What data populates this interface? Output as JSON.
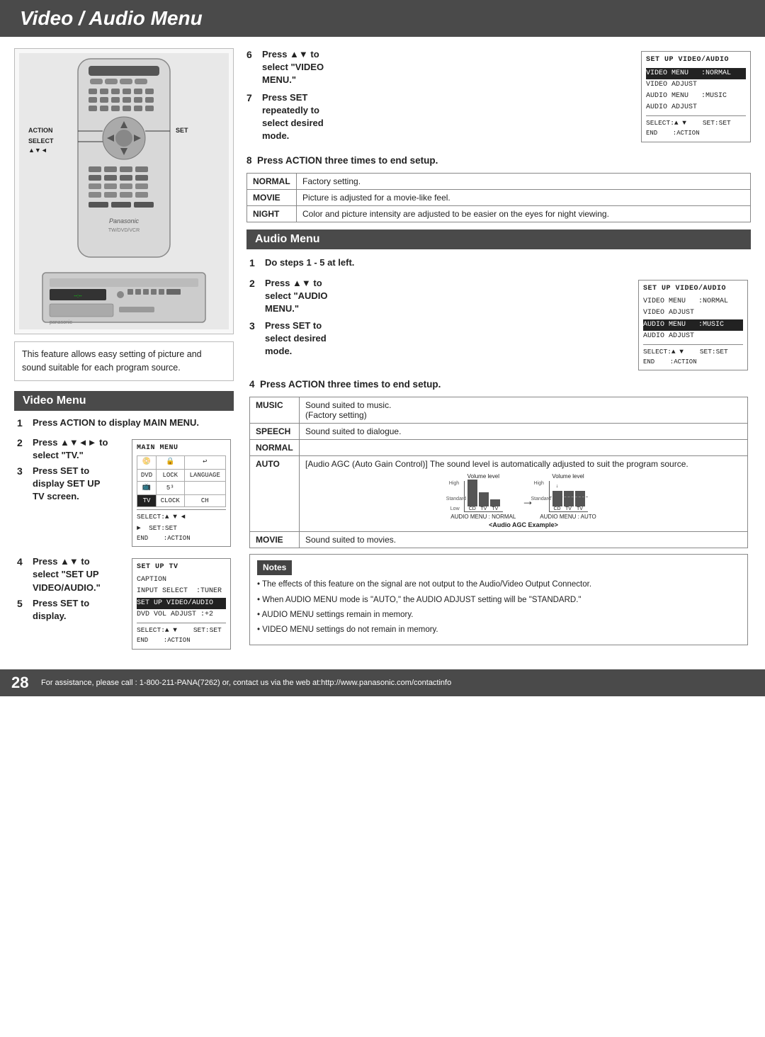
{
  "page": {
    "title": "Video / Audio Menu",
    "number": "28",
    "footer_text": "For assistance, please call : 1-800-211-PANA(7262) or, contact us via the web at:http://www.panasonic.com/contactinfo"
  },
  "description": "This feature allows easy setting of picture and sound suitable for each program source.",
  "video_menu_section": {
    "heading": "Video Menu",
    "steps": [
      {
        "num": "1",
        "text": "Press ACTION to display MAIN MENU."
      },
      {
        "num": "2",
        "text": "Press ▲▼◄► to select \"TV.\""
      },
      {
        "num": "3",
        "text": "Press SET to display SET UP TV screen."
      },
      {
        "num": "4",
        "text": "Press ▲▼ to select \"SET UP VIDEO/AUDIO.\""
      },
      {
        "num": "5",
        "text": "Press SET to display."
      }
    ]
  },
  "main_menu_box": {
    "title": "MAIN MENU",
    "items": [
      "DVD",
      "LOCK",
      "LANGUAGE",
      "",
      "TV",
      "CLOCK",
      "CH"
    ],
    "footer_select": "SELECT:▲ ▼ ◄ ►  SET:SET",
    "footer_end": "END     :ACTION"
  },
  "setup_tv_box": {
    "title": "SET UP TV",
    "items": [
      "CAPTION",
      "INPUT SELECT   :TUNER",
      "SET UP VIDEO/AUDIO",
      "DVD VOL ADJUST :+2"
    ],
    "highlighted": "SET UP VIDEO/AUDIO",
    "footer_select": "SELECT:▲ ▼     SET:SET",
    "footer_end": "END     :ACTION"
  },
  "right_col": {
    "step6": {
      "num": "6",
      "text": "Press ▲▼ to select \"VIDEO MENU.\""
    },
    "step7": {
      "num": "7",
      "text": "Press SET repeatedly to select desired mode."
    },
    "setup_video_audio_box1": {
      "title": "SET UP VIDEO/AUDIO",
      "items": [
        "VIDEO MENU   :NORMAL",
        "VIDEO ADJUST",
        "AUDIO MENU   :MUSIC",
        "AUDIO ADJUST"
      ],
      "highlighted": "VIDEO MENU   :NORMAL",
      "footer_select": "SELECT:▲ ▼     SET:SET",
      "footer_end": "END     :ACTION"
    },
    "step8": "Press ACTION three times to end setup.",
    "video_modes": [
      {
        "mode": "NORMAL",
        "desc": "Factory setting."
      },
      {
        "mode": "MOVIE",
        "desc": "Picture is adjusted for a movie-like feel."
      },
      {
        "mode": "NIGHT",
        "desc": "Color and picture intensity are adjusted to be easier on the eyes for night viewing."
      }
    ]
  },
  "audio_menu_section": {
    "heading": "Audio Menu",
    "step1": "Do steps 1 - 5 at left.",
    "step2": "Press ▲▼ to select \"AUDIO MENU.\"",
    "step3": "Press SET to select desired mode.",
    "setup_video_audio_box2": {
      "title": "SET UP VIDEO/AUDIO",
      "items": [
        "VIDEO MENU   :NORMAL",
        "VIDEO ADJUST",
        "AUDIO MENU   :MUSIC",
        "AUDIO ADJUST"
      ],
      "highlighted": "AUDIO MENU   :MUSIC",
      "footer_select": "SELECT:▲ ▼     SET:SET",
      "footer_end": "END     :ACTION"
    },
    "step4": "Press ACTION three times to end setup.",
    "audio_modes": [
      {
        "mode": "MUSIC",
        "desc": "Sound suited to music. (Factory setting)"
      },
      {
        "mode": "SPEECH",
        "desc": "Sound suited to dialogue."
      },
      {
        "mode": "NORMAL",
        "desc": ""
      },
      {
        "mode": "AUTO",
        "desc": "[Audio AGC (Auto Gain Control)] The sound level is automatically adjusted to suit the program source."
      },
      {
        "mode": "MOVIE",
        "desc": "Sound suited to movies."
      }
    ],
    "agc_label": "<Audio AGC Example>",
    "agc_normal_label": "AUDIO MENU : NORMAL",
    "agc_auto_label": "AUDIO MENU : AUTO"
  },
  "notes": {
    "header": "Notes",
    "items": [
      "The effects of this feature on the signal are not output to the Audio/Video Output Connector.",
      "When AUDIO MENU mode is \"AUTO,\" the AUDIO ADJUST setting will be \"STANDARD.\"",
      "AUDIO MENU settings remain in memory.",
      "VIDEO MENU settings do not remain in memory."
    ]
  },
  "labels": {
    "action": "ACTION",
    "select": "SELECT",
    "set": "SET",
    "arrows": "▲▼◄"
  }
}
